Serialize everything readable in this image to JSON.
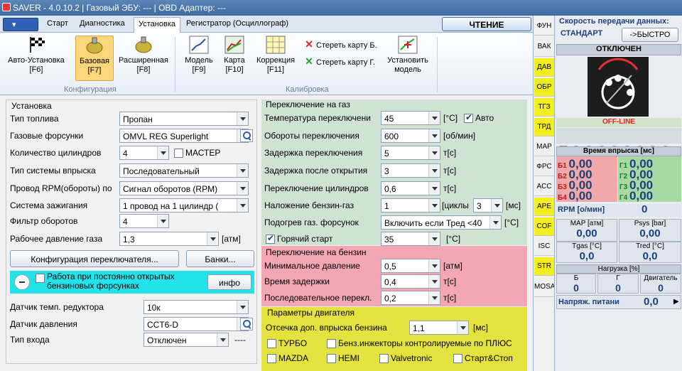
{
  "window": {
    "title": "SAVER - 4.0.10.2  |  Газовый ЭБУ: ---  |  OBD Адаптер: ---"
  },
  "tabs": [
    "Старт",
    "Диагностика",
    "Установка",
    "Регистратор (Осциллограф)"
  ],
  "read_button": "ЧТЕНИЕ",
  "ribbon": {
    "auto_install": "Авто-Установка",
    "auto_key": "[F6]",
    "base": "Базовая",
    "base_key": "[F7]",
    "extended": "Расширенная",
    "extended_key": "[F8]",
    "config_group": "Конфигурация",
    "model": "Модель",
    "model_key": "[F9]",
    "map": "Карта",
    "map_key": "[F10]",
    "correction": "Коррекция",
    "correction_key": "[F11]",
    "erase_b": "Стереть карту Б.",
    "erase_g": "Стереть карту Г.",
    "set_model_1": "Установить",
    "set_model_2": "модель",
    "calib_group": "Калибровка"
  },
  "install": {
    "header": "Установка",
    "fuel_type_label": "Тип топлива",
    "fuel_type": "Пропан",
    "injectors_label": "Газовые форсунки",
    "injectors": "OMVL REG Superlight",
    "cyl_count_label": "Количество цилиндров",
    "cyl_count": "4",
    "master": "МАСТЕР",
    "inj_system_label": "Тип системы впрыска",
    "inj_system": "Последовательный",
    "rpm_wire_label": "Провод RPM(обороты) по",
    "rpm_wire": "Сигнал оборотов (RPM)",
    "ignition_label": "Система зажигания",
    "ignition": "1 провод на 1 цилиндр (",
    "rpm_filter_label": "Фильтр оборотов",
    "rpm_filter": "4",
    "gas_pressure_label": "Рабочее давление газа",
    "gas_pressure": "1,3",
    "gas_pressure_unit": "[атм]",
    "switch_config_btn": "Конфигурация переключателя...",
    "banks_btn": "Банки...",
    "open_inj_line1": "Работа при постоянно открытых",
    "open_inj_line2": "бензиновых форсунках",
    "info_btn": "инфо",
    "reducer_temp_label": "Датчик темп. редуктора",
    "reducer_temp": "10к",
    "pressure_sensor_label": "Датчик давления",
    "pressure_sensor": "CCT6-D",
    "input_type_label": "Тип входа",
    "input_type": "Отключен",
    "input_dash": "----"
  },
  "gas_switch": {
    "header": "Переключение на газ",
    "temp_label": "Температура переключени",
    "temp": "45",
    "temp_unit": "[°C]",
    "auto": "Авто",
    "rpm_label": "Обороты переключения",
    "rpm": "600",
    "rpm_unit": "[об/мин]",
    "delay_label": "Задержка переключения",
    "delay": "5",
    "delay_unit": "т[с]",
    "delay_open_label": "Задержка после открытия",
    "delay_open": "3",
    "delay_open_unit": "т[с]",
    "cyl_switch_label": "Переключение цилиндров",
    "cyl_switch": "0,6",
    "cyl_switch_unit": "т[с]",
    "overlap_label": "Наложение бензин-газ",
    "overlap": "1",
    "overlap_cycles": "[циклы",
    "overlap2": "3",
    "overlap_unit": "[мс]",
    "heat_label": "Подогрев газ. форсунок",
    "heat": "Включить если Тред <40",
    "heat_unit": "[°C]",
    "hot_start": "Горячий старт",
    "hot_start_val": "35",
    "hot_start_unit": "[°C]"
  },
  "petrol_switch": {
    "header": "Переключение на бензин",
    "min_pressure_label": "Минимальное давление",
    "min_pressure": "0,5",
    "min_pressure_unit": "[атм]",
    "delay_label": "Время задержки",
    "delay": "0,4",
    "delay_unit": "т[с]",
    "seq_label": "Последовательное перекл.",
    "seq": "0,2",
    "seq_unit": "т[с]"
  },
  "engine": {
    "header": "Параметры двигателя",
    "cutoff_label": "Отсечка доп. впрыска бензина",
    "cutoff": "1,1",
    "cutoff_unit": "[мс]",
    "turbo": "ТУРБО",
    "petrol_inj": "Бенз.инжекторы контролируемые по ПЛЮС",
    "mazda": "MAZDA",
    "hemi": "HEMI",
    "valvetronic": "Valvetronic",
    "startstop": "Старт&Стоп"
  },
  "side_tabs": [
    "ФУН",
    "ВАК",
    "ДАВ",
    "ОБР",
    "ТГЗ",
    "ТРД",
    "MAP",
    "ФРС",
    "ACC",
    "APE",
    "COF",
    "ISC",
    "STR",
    "MOSA"
  ],
  "right": {
    "speed_title": "Скорость передачи данных:",
    "speed_value": "СТАНДАРТ",
    "speed_btn": "->БЫСТРО",
    "state": "ОТКЛЮЧЕН",
    "offline": "OFF-LINE",
    "inj_time_hdr": "Время впрыска [мс]",
    "b1": "Б1",
    "b1v": "0,00",
    "g1": "Г1",
    "g1v": "0,00",
    "b2": "Б2",
    "b2v": "0,00",
    "g2": "Г2",
    "g2v": "0,00",
    "b3": "Б3",
    "b3v": "0,00",
    "g3": "Г3",
    "g3v": "0,00",
    "b4": "Б4",
    "b4v": "0,00",
    "g4": "Г4",
    "g4v": "0,00",
    "rpm_label": "RPM [о/мин]",
    "rpm": "0",
    "map_label": "MAP [атм]",
    "map": "0,00",
    "psys_label": "Psys [bar]",
    "psys": "0,00",
    "tgas_label": "Tgas [°C]",
    "tgas": "0,0",
    "tred_label": "Tred [°C]",
    "tred": "0,0",
    "load_hdr": "Нагрузка [%]",
    "load_b": "Б",
    "load_g": "Г",
    "load_e": "Двигатель",
    "load_bv": "0",
    "load_gv": "0",
    "load_ev": "0",
    "voltage_label": "Напряж. питани",
    "voltage": "0,0"
  }
}
